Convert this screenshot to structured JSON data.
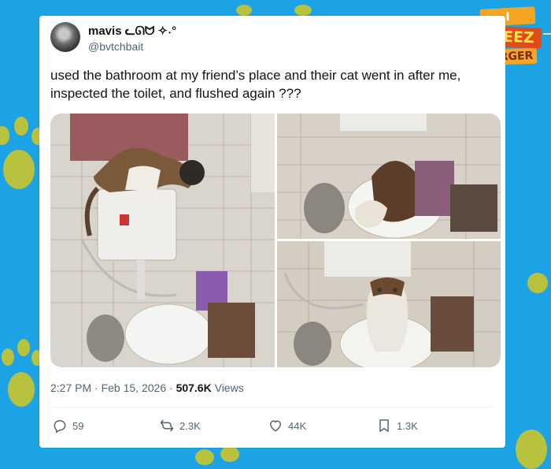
{
  "post": {
    "display_name": "mavis ᓚᘏᗢ ✧˖°",
    "handle": "@bvtchbait",
    "text": "used the bathroom at my friend’s place and their cat went in after me, inspected the toilet, and flushed again ???",
    "time": "2:27 PM",
    "date": "Feb 15, 2026",
    "views_count": "507.6K",
    "views_label": "Views",
    "separator": "·"
  },
  "actions": {
    "replies": "59",
    "reposts": "2.3K",
    "likes": "44K",
    "bookmarks": "1.3K"
  },
  "logo": {
    "line1": "I CANHAS",
    "line2": "CHEEZ",
    "line3": "BURGER"
  },
  "images": [
    {
      "icon": "cat-on-toilet-tank-photo"
    },
    {
      "icon": "cat-inspecting-toilet-photo"
    },
    {
      "icon": "cat-sitting-on-toilet-photo"
    }
  ],
  "colors": {
    "background": "#1ba3e6",
    "paw": "#b8c23e",
    "card": "#ffffff",
    "text": "#0f1419",
    "muted": "#536471"
  }
}
